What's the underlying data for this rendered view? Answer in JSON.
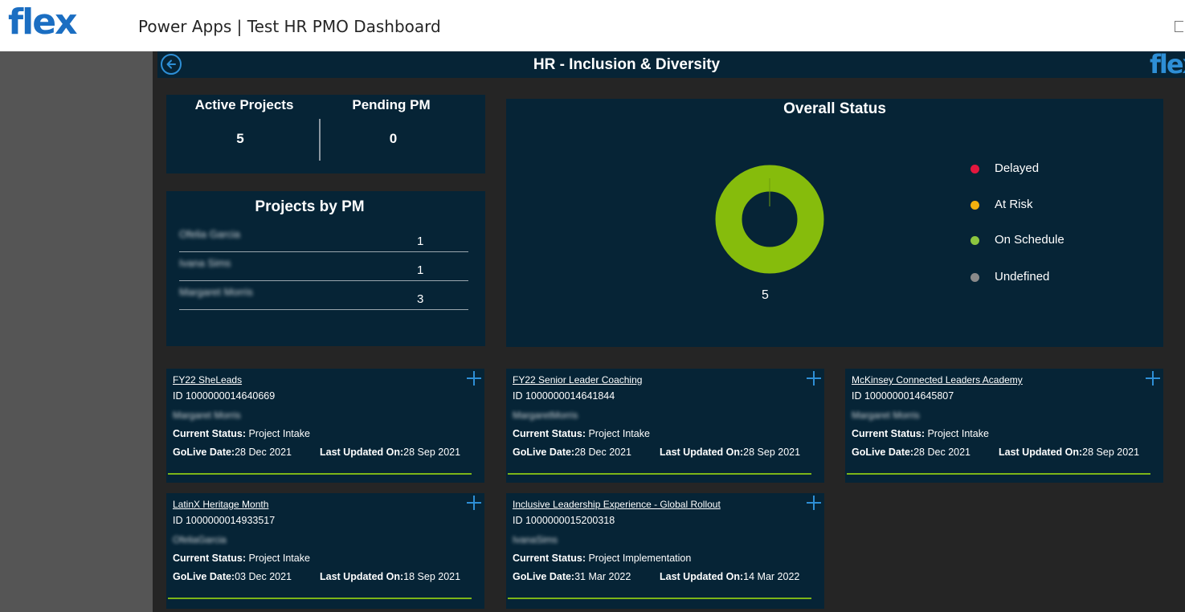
{
  "header": {
    "brand": "flex",
    "title": "Power Apps | Test HR PMO Dashboard"
  },
  "titlebar": {
    "title": "HR - Inclusion & Diversity",
    "brand_mini": "flex"
  },
  "kpis": {
    "active_label": "Active Projects",
    "active_value": "5",
    "pending_label": "Pending PM",
    "pending_value": "0"
  },
  "projects_by_pm": {
    "title": "Projects by PM",
    "rows": [
      {
        "name": "Ofelia Garcia",
        "count": "1"
      },
      {
        "name": "Ivana Sims",
        "count": "1"
      },
      {
        "name": "Margaret Morris",
        "count": "3"
      }
    ]
  },
  "overall_status": {
    "title": "Overall Status",
    "total": "5",
    "legend": [
      {
        "label": "Delayed",
        "color": "#e3173e"
      },
      {
        "label": "At Risk",
        "color": "#f2b10f"
      },
      {
        "label": "On Schedule",
        "color": "#8cc63f"
      },
      {
        "label": "Undefined",
        "color": "#8a8a8a"
      }
    ],
    "segments": {
      "Delayed": 0,
      "At Risk": 0,
      "On Schedule": 5,
      "Undefined": 0
    },
    "donut_color": "#86bc0c"
  },
  "cards": [
    {
      "title": "FY22 SheLeads",
      "id": "ID 1000000014640669",
      "owner": "Margaret Morris",
      "status_label": "Current Status:",
      "status_value": "Project Intake",
      "golive_label": "GoLive Date:",
      "golive_value": "28 Dec 2021",
      "updated_label": "Last Updated On:",
      "updated_value": "28 Sep 2021"
    },
    {
      "title": "FY22 Senior Leader Coaching",
      "id": "ID 1000000014641844",
      "owner": "MargaretMorris",
      "status_label": "Current Status:",
      "status_value": "Project Intake",
      "golive_label": "GoLive Date:",
      "golive_value": "28 Dec 2021",
      "updated_label": "Last Updated On:",
      "updated_value": "28 Sep 2021"
    },
    {
      "title": "McKinsey Connected Leaders Academy",
      "id": "ID 1000000014645807",
      "owner": "Margaret Morris",
      "status_label": "Current Status:",
      "status_value": "Project Intake",
      "golive_label": "GoLive Date:",
      "golive_value": "28 Dec 2021",
      "updated_label": "Last Updated On:",
      "updated_value": "28 Sep 2021"
    },
    {
      "title": "LatinX Heritage Month",
      "id": "ID 1000000014933517",
      "owner": "OfeliaGarcia",
      "status_label": "Current Status:",
      "status_value": "Project Intake",
      "golive_label": "GoLive Date:",
      "golive_value": "03 Dec 2021",
      "updated_label": "Last Updated On:",
      "updated_value": "18 Sep 2021"
    },
    {
      "title": "Inclusive Leadership Experience - Global Rollout",
      "id": "ID 1000000015200318",
      "owner": "IvanaSims",
      "status_label": "Current Status:",
      "status_value": "Project Implementation",
      "golive_label": "GoLive Date:",
      "golive_value": "31 Mar 2022",
      "updated_label": "Last Updated On:",
      "updated_value": "14 Mar 2022"
    }
  ]
}
